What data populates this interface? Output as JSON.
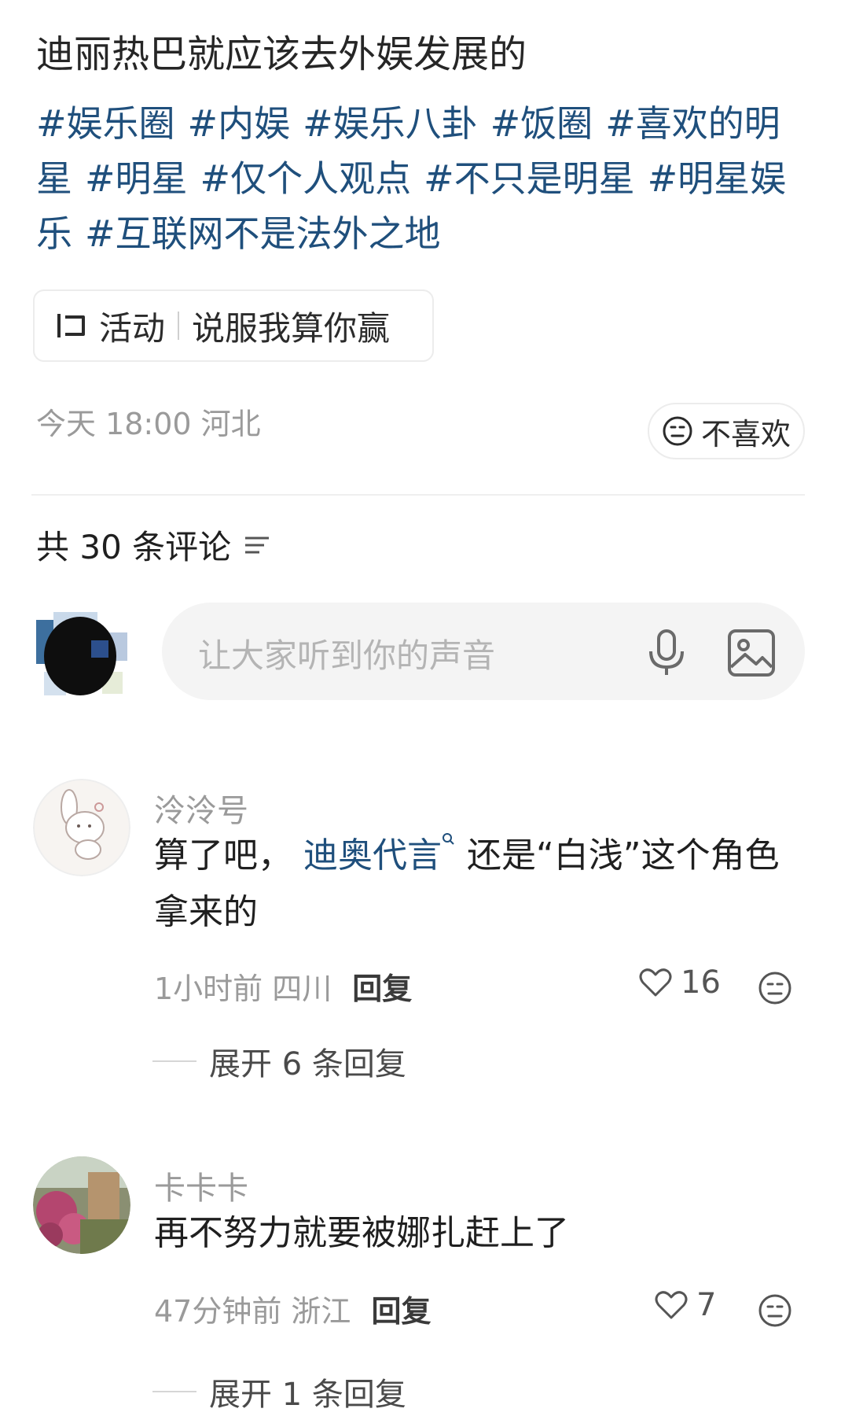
{
  "post": {
    "title": "迪丽热巴就应该去外娱发展的",
    "tags": [
      "#娱乐圈",
      "#内娱",
      "#娱乐八卦",
      "#饭圈",
      "#喜欢的明星",
      "#明星",
      "#仅个人观点",
      "#不只是明星",
      "#明星娱乐",
      "#互联网不是法外之地"
    ],
    "activity": {
      "label": "活动",
      "name": "说服我算你赢"
    },
    "meta": "今天 18:00 河北",
    "dislike_label": "不喜欢"
  },
  "comments_header": {
    "count_label": "共 30 条评论"
  },
  "comment_input": {
    "placeholder": "让大家听到你的声音"
  },
  "comments": [
    {
      "username": "泠泠号",
      "text_before": "算了吧， ",
      "link": "迪奥代言",
      "text_after": " 还是“白浅”这个角色拿来的",
      "time_location": "1小时前 四川",
      "reply_label": "回复",
      "likes": "16",
      "expand_label": "展开 6 条回复"
    },
    {
      "username": "卡卡卡",
      "text_before": "再不努力就要被娜扎赶上了",
      "link": "",
      "text_after": "",
      "time_location": "47分钟前 浙江",
      "reply_label": "回复",
      "likes": "7",
      "expand_label": "展开 1 条回复"
    }
  ],
  "icons": {
    "activity": "activity-icon",
    "dislike": "neutral-face-icon",
    "sort": "sort-icon",
    "mic": "microphone-icon",
    "image": "image-icon",
    "like": "heart-icon",
    "comment_dislike": "neutral-face-icon",
    "search_mark": "search-mark-icon"
  },
  "colors": {
    "tag_link": "#1f4f7c",
    "muted_text": "#9a9a9a",
    "input_bg": "#f4f4f4",
    "border": "#ececec"
  }
}
